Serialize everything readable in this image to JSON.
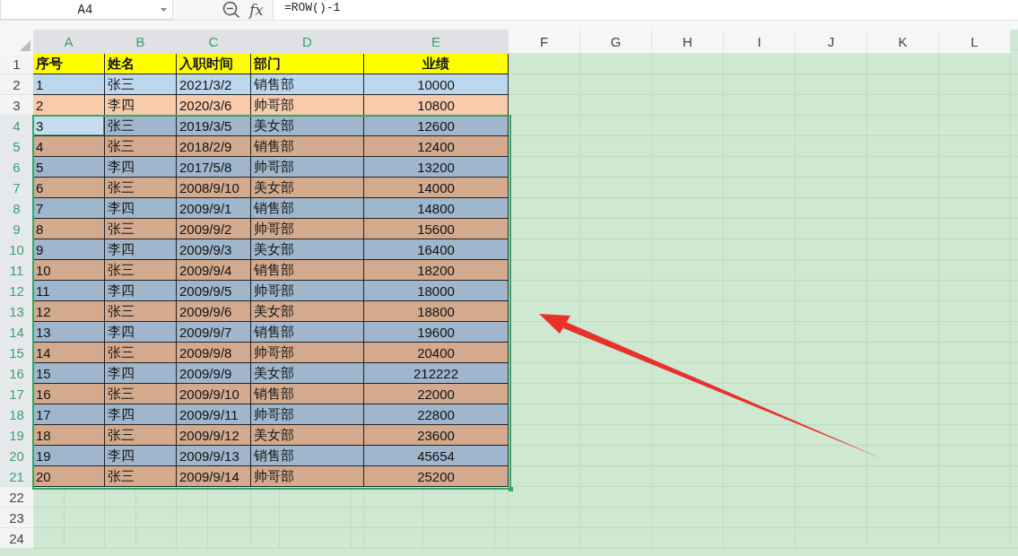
{
  "formula_bar": {
    "cell_ref": "A4",
    "fx": "fx",
    "formula": "=ROW()-1"
  },
  "columns": [
    {
      "label": "A",
      "selected": true
    },
    {
      "label": "B",
      "selected": true
    },
    {
      "label": "C",
      "selected": true
    },
    {
      "label": "D",
      "selected": true
    },
    {
      "label": "E",
      "selected": true
    },
    {
      "label": "F",
      "selected": false
    },
    {
      "label": "G",
      "selected": false
    },
    {
      "label": "H",
      "selected": false
    },
    {
      "label": "I",
      "selected": false
    },
    {
      "label": "J",
      "selected": false
    },
    {
      "label": "K",
      "selected": false
    },
    {
      "label": "L",
      "selected": false
    }
  ],
  "rows": [
    {
      "number": "1",
      "selected": false,
      "active": false,
      "color": "#ffff00",
      "header": true,
      "cells": [
        "序号",
        "姓名",
        "入职时间",
        "部门",
        "业绩"
      ]
    },
    {
      "number": "2",
      "selected": false,
      "active": false,
      "color": "#bdd7ee",
      "header": false,
      "cells": [
        "1",
        "张三",
        "2021/3/2",
        "销售部",
        "10000"
      ]
    },
    {
      "number": "3",
      "selected": false,
      "active": false,
      "color": "#f8cbad",
      "header": false,
      "cells": [
        "2",
        "李四",
        "2020/3/6",
        "帅哥部",
        "10800"
      ]
    },
    {
      "number": "4",
      "selected": true,
      "active": true,
      "color": "#9fb6cc",
      "header": false,
      "cells": [
        "3",
        "张三",
        "2019/3/5",
        "美女部",
        "12600"
      ]
    },
    {
      "number": "5",
      "selected": true,
      "active": false,
      "color": "#d3aa8e",
      "header": false,
      "cells": [
        "4",
        "张三",
        "2018/2/9",
        "销售部",
        "12400"
      ]
    },
    {
      "number": "6",
      "selected": true,
      "active": false,
      "color": "#9fb6cc",
      "header": false,
      "cells": [
        "5",
        "李四",
        "2017/5/8",
        "帅哥部",
        "13200"
      ]
    },
    {
      "number": "7",
      "selected": true,
      "active": false,
      "color": "#d3aa8e",
      "header": false,
      "cells": [
        "6",
        "张三",
        "2008/9/10",
        "美女部",
        "14000"
      ]
    },
    {
      "number": "8",
      "selected": true,
      "active": false,
      "color": "#9fb6cc",
      "header": false,
      "cells": [
        "7",
        "李四",
        "2009/9/1",
        "销售部",
        "14800"
      ]
    },
    {
      "number": "9",
      "selected": true,
      "active": false,
      "color": "#d3aa8e",
      "header": false,
      "cells": [
        "8",
        "张三",
        "2009/9/2",
        "帅哥部",
        "15600"
      ]
    },
    {
      "number": "10",
      "selected": true,
      "active": false,
      "color": "#9fb6cc",
      "header": false,
      "cells": [
        "9",
        "李四",
        "2009/9/3",
        "美女部",
        "16400"
      ]
    },
    {
      "number": "11",
      "selected": true,
      "active": false,
      "color": "#d3aa8e",
      "header": false,
      "cells": [
        "10",
        "张三",
        "2009/9/4",
        "销售部",
        "18200"
      ]
    },
    {
      "number": "12",
      "selected": true,
      "active": false,
      "color": "#9fb6cc",
      "header": false,
      "cells": [
        "11",
        "李四",
        "2009/9/5",
        "帅哥部",
        "18000"
      ]
    },
    {
      "number": "13",
      "selected": true,
      "active": false,
      "color": "#d3aa8e",
      "header": false,
      "cells": [
        "12",
        "张三",
        "2009/9/6",
        "美女部",
        "18800"
      ]
    },
    {
      "number": "14",
      "selected": true,
      "active": false,
      "color": "#9fb6cc",
      "header": false,
      "cells": [
        "13",
        "李四",
        "2009/9/7",
        "销售部",
        "19600"
      ]
    },
    {
      "number": "15",
      "selected": true,
      "active": false,
      "color": "#d3aa8e",
      "header": false,
      "cells": [
        "14",
        "张三",
        "2009/9/8",
        "帅哥部",
        "20400"
      ]
    },
    {
      "number": "16",
      "selected": true,
      "active": false,
      "color": "#9fb6cc",
      "header": false,
      "cells": [
        "15",
        "李四",
        "2009/9/9",
        "美女部",
        "212222"
      ]
    },
    {
      "number": "17",
      "selected": true,
      "active": false,
      "color": "#d3aa8e",
      "header": false,
      "cells": [
        "16",
        "张三",
        "2009/9/10",
        "销售部",
        "22000"
      ]
    },
    {
      "number": "18",
      "selected": true,
      "active": false,
      "color": "#9fb6cc",
      "header": false,
      "cells": [
        "17",
        "李四",
        "2009/9/11",
        "帅哥部",
        "22800"
      ]
    },
    {
      "number": "19",
      "selected": true,
      "active": false,
      "color": "#d3aa8e",
      "header": false,
      "cells": [
        "18",
        "张三",
        "2009/9/12",
        "美女部",
        "23600"
      ]
    },
    {
      "number": "20",
      "selected": true,
      "active": false,
      "color": "#9fb6cc",
      "header": false,
      "cells": [
        "19",
        "李四",
        "2009/9/13",
        "销售部",
        "45654"
      ]
    },
    {
      "number": "21",
      "selected": true,
      "active": false,
      "color": "#d3aa8e",
      "header": false,
      "cells": [
        "20",
        "张三",
        "2009/9/14",
        "帅哥部",
        "25200"
      ]
    }
  ],
  "empty_rows": [
    "22",
    "23",
    "24"
  ]
}
